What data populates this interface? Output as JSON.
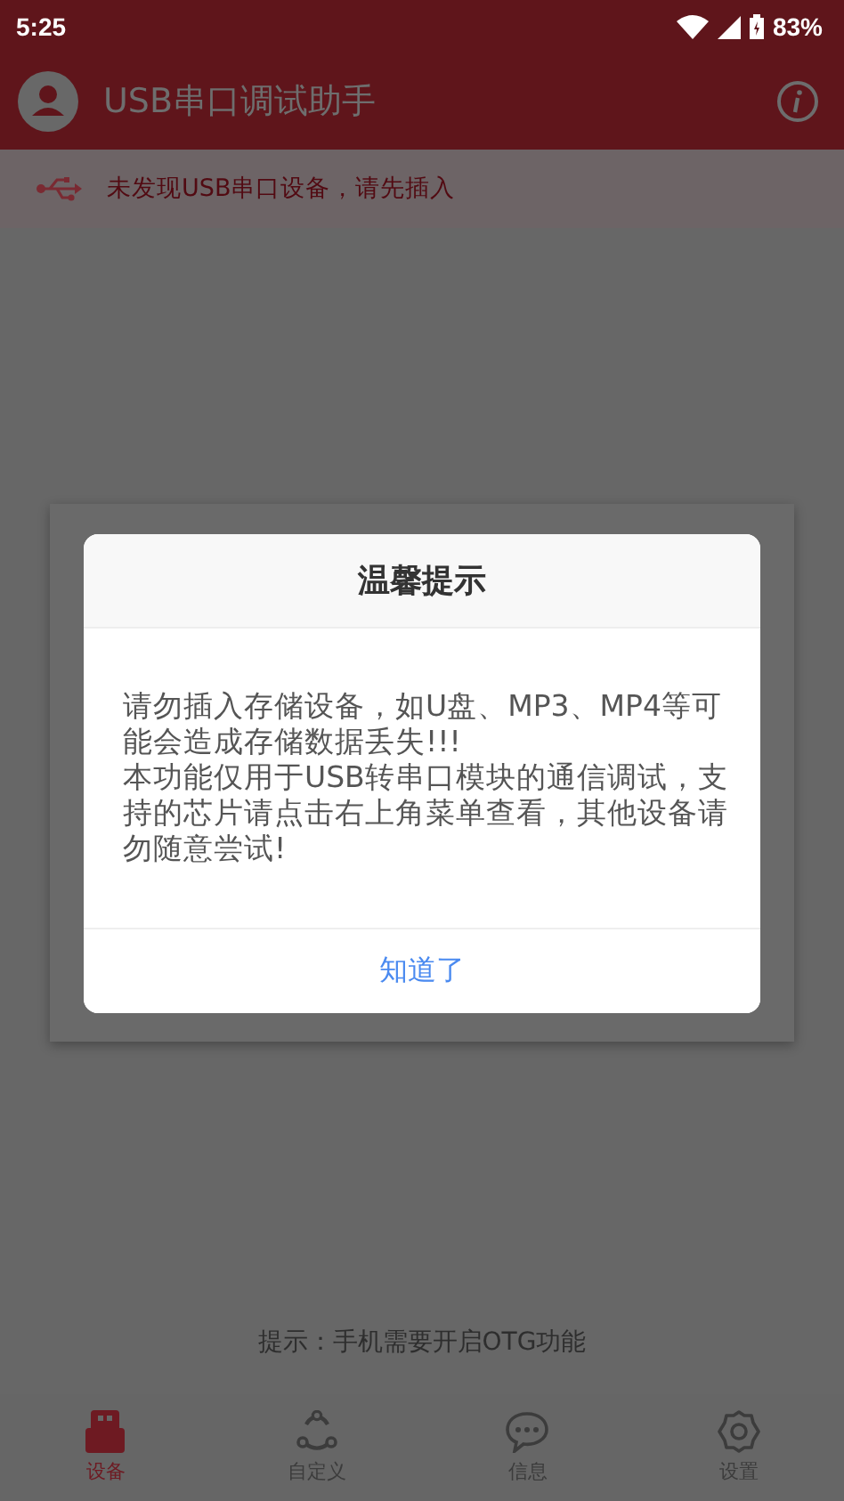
{
  "status_bar": {
    "time": "5:25",
    "battery": "83%"
  },
  "app_bar": {
    "title": "USB串口调试助手"
  },
  "banner": {
    "text": "未发现USB串口设备，请先插入"
  },
  "hint": "提示：手机需要开启OTG功能",
  "dialog": {
    "title": "温馨提示",
    "paragraphs": [
      "请勿插入存储设备，如U盘、MP3、MP4等可能会造成存储数据丢失!!!",
      "本功能仅用于USB转串口模块的通信调试，支持的芯片请点击右上角菜单查看，其他设备请勿随意尝试!"
    ],
    "button": "知道了"
  },
  "bottom_nav": [
    {
      "kind": "usb",
      "label": "设备",
      "selected": true
    },
    {
      "kind": "share",
      "label": "自定义",
      "selected": false
    },
    {
      "kind": "chat",
      "label": "信息",
      "selected": false
    },
    {
      "kind": "gear",
      "label": "设置",
      "selected": false
    }
  ]
}
